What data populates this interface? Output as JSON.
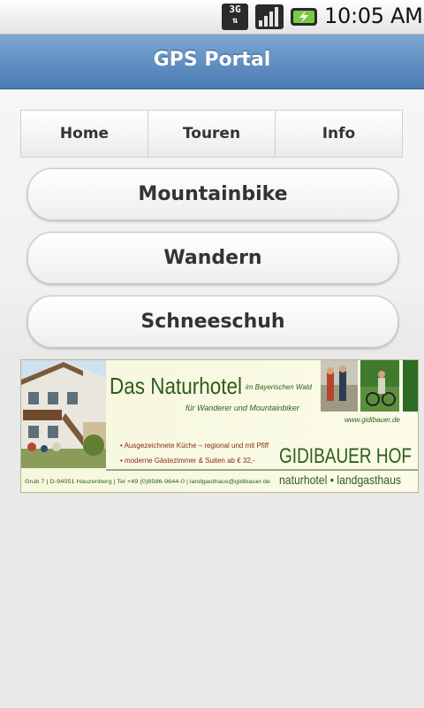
{
  "status_bar": {
    "network": "3G",
    "time": "10:05 AM"
  },
  "header": {
    "title": "GPS Portal"
  },
  "navbar": {
    "items": [
      "Home",
      "Touren",
      "Info"
    ]
  },
  "buttons": [
    "Mountainbike",
    "Wandern",
    "Schneeschuh"
  ],
  "ad": {
    "headline": "Das Naturhotel",
    "headline_sub": "im Bayerischen Wald",
    "tagline": "für Wanderer und Mountainbiker",
    "website": "www.gidibauer.de",
    "bullet_1": "• Ausgezeichnete Küche – regional und mit Pfiff",
    "bullet_2": "• moderne Gästezimmer & Suiten ab € 32,-",
    "brand": "GIDIBAUER HOF",
    "brand_sub": "naturhotel • landgasthaus",
    "address": "Grub 7 | D-94051 Hauzenberg | Tel +49 (0)8586-9644-0 | landgasthaus@gidibauer.de"
  },
  "colors": {
    "header_top": "#7da7d4",
    "header_bottom": "#4a7ab3",
    "ad_green": "#2e5d1e"
  }
}
